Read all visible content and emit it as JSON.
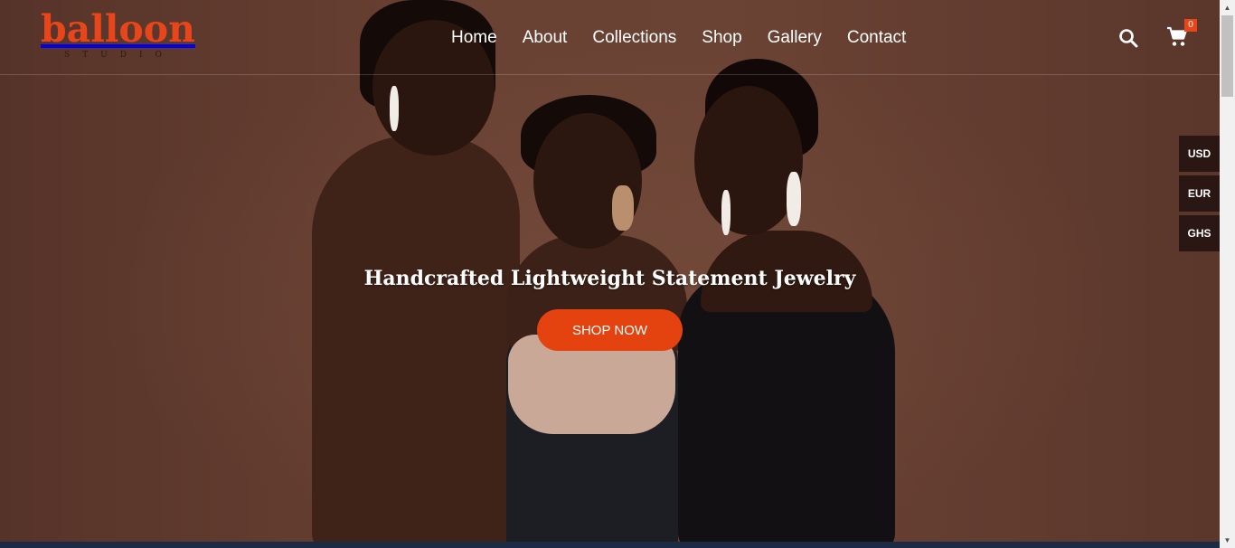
{
  "brand": {
    "name": "balloon",
    "subtitle": "STUDIO",
    "accent": "#e8461a"
  },
  "nav": {
    "items": [
      {
        "label": "Home"
      },
      {
        "label": "About"
      },
      {
        "label": "Collections"
      },
      {
        "label": "Shop"
      },
      {
        "label": "Gallery"
      },
      {
        "label": "Contact"
      }
    ]
  },
  "header": {
    "search_icon": "search-icon",
    "cart_icon": "cart-icon",
    "cart_count": "0"
  },
  "currencies": [
    "USD",
    "EUR",
    "GHS"
  ],
  "hero": {
    "headline": "Handcrafted Lightweight Statement Jewelry",
    "cta_label": "SHOP NOW",
    "cta_color": "#e4420e"
  }
}
